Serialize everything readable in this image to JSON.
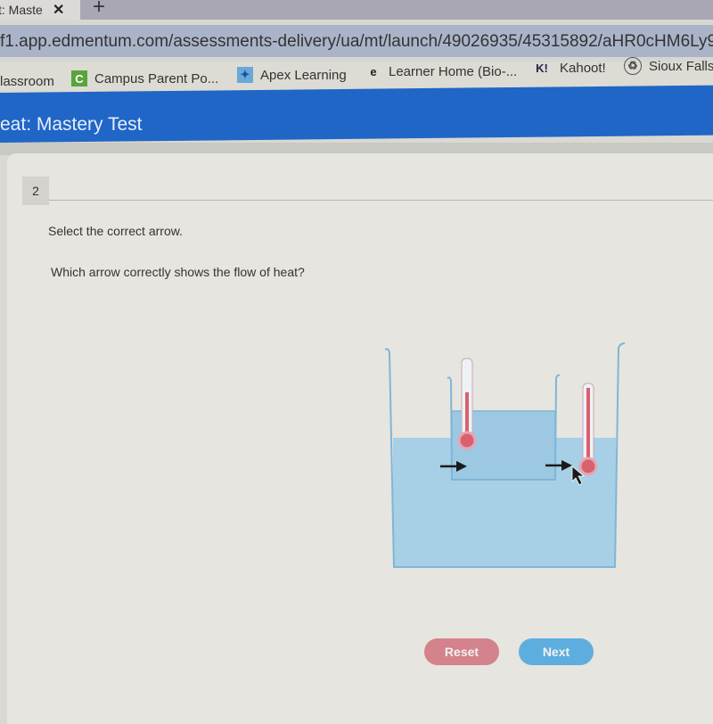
{
  "browser": {
    "tab_title": "t: Maste",
    "tab_close": "✕",
    "new_tab": "+",
    "url": "f1.app.edmentum.com/assessments-delivery/ua/mt/launch/49026935/45315892/aHR0cHM6Ly9mMS5",
    "bookmarks": [
      {
        "label": "lassroom",
        "icon": ""
      },
      {
        "label": "Campus Parent Po...",
        "icon": "C"
      },
      {
        "label": "Apex Learning",
        "icon": "apex-icon"
      },
      {
        "label": "Learner Home (Bio-...",
        "icon": "e"
      },
      {
        "label": "Kahoot!",
        "icon": "K!"
      },
      {
        "label": "Sioux Falls",
        "icon": "recycle-icon"
      }
    ]
  },
  "header": {
    "title": "eat: Mastery Test"
  },
  "question": {
    "number": "2",
    "instruction": "Select the correct arrow.",
    "prompt": "Which arrow correctly shows the flow of heat?"
  },
  "diagram": {
    "arrows": [
      {
        "id": "arrow-1",
        "direction": "right",
        "location": "outer water into inner beaker"
      },
      {
        "id": "arrow-2",
        "direction": "right",
        "location": "inner beaker into outer water"
      }
    ],
    "colors": {
      "water": "#a7cfe6",
      "glass": "#7fb6d8",
      "mercury": "#d9616f"
    }
  },
  "buttons": {
    "reset": "Reset",
    "next": "Next"
  }
}
